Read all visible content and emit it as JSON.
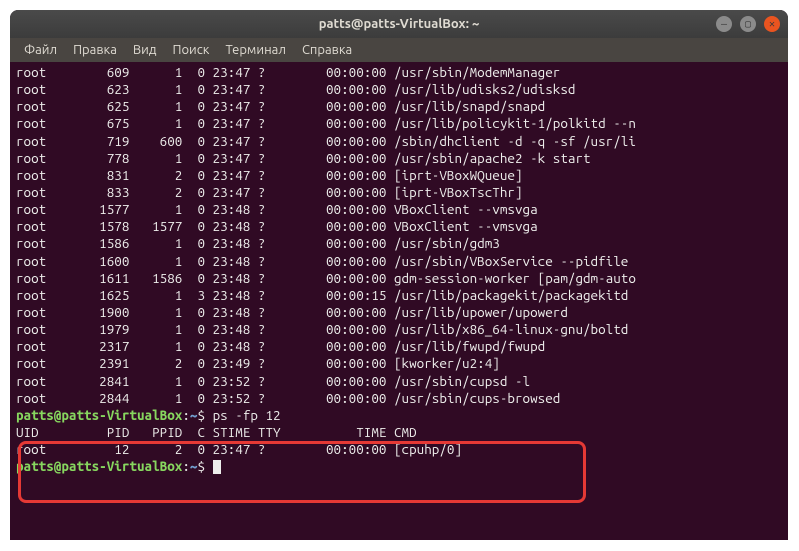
{
  "window": {
    "title": "patts@patts-VirtualBox: ~"
  },
  "menu": {
    "file": "Файл",
    "edit": "Правка",
    "view": "Вид",
    "search": "Поиск",
    "terminal": "Терминал",
    "help": "Справка"
  },
  "ps_rows": [
    {
      "uid": "root",
      "pid": "609",
      "ppid": "1",
      "c": "0",
      "stime": "23:47",
      "tty": "?",
      "time": "00:00:00",
      "cmd": "/usr/sbin/ModemManager"
    },
    {
      "uid": "root",
      "pid": "623",
      "ppid": "1",
      "c": "0",
      "stime": "23:47",
      "tty": "?",
      "time": "00:00:00",
      "cmd": "/usr/lib/udisks2/udisksd"
    },
    {
      "uid": "root",
      "pid": "625",
      "ppid": "1",
      "c": "0",
      "stime": "23:47",
      "tty": "?",
      "time": "00:00:00",
      "cmd": "/usr/lib/snapd/snapd"
    },
    {
      "uid": "root",
      "pid": "675",
      "ppid": "1",
      "c": "0",
      "stime": "23:47",
      "tty": "?",
      "time": "00:00:00",
      "cmd": "/usr/lib/policykit-1/polkitd --n"
    },
    {
      "uid": "root",
      "pid": "719",
      "ppid": "600",
      "c": "0",
      "stime": "23:47",
      "tty": "?",
      "time": "00:00:00",
      "cmd": "/sbin/dhclient -d -q -sf /usr/li"
    },
    {
      "uid": "root",
      "pid": "778",
      "ppid": "1",
      "c": "0",
      "stime": "23:47",
      "tty": "?",
      "time": "00:00:00",
      "cmd": "/usr/sbin/apache2 -k start"
    },
    {
      "uid": "root",
      "pid": "831",
      "ppid": "2",
      "c": "0",
      "stime": "23:47",
      "tty": "?",
      "time": "00:00:00",
      "cmd": "[iprt-VBoxWQueue]"
    },
    {
      "uid": "root",
      "pid": "833",
      "ppid": "2",
      "c": "0",
      "stime": "23:47",
      "tty": "?",
      "time": "00:00:00",
      "cmd": "[iprt-VBoxTscThr]"
    },
    {
      "uid": "root",
      "pid": "1577",
      "ppid": "1",
      "c": "0",
      "stime": "23:48",
      "tty": "?",
      "time": "00:00:00",
      "cmd": "VBoxClient --vmsvga"
    },
    {
      "uid": "root",
      "pid": "1578",
      "ppid": "1577",
      "c": "0",
      "stime": "23:48",
      "tty": "?",
      "time": "00:00:00",
      "cmd": "VBoxClient --vmsvga"
    },
    {
      "uid": "root",
      "pid": "1586",
      "ppid": "1",
      "c": "0",
      "stime": "23:48",
      "tty": "?",
      "time": "00:00:00",
      "cmd": "/usr/sbin/gdm3"
    },
    {
      "uid": "root",
      "pid": "1600",
      "ppid": "1",
      "c": "0",
      "stime": "23:48",
      "tty": "?",
      "time": "00:00:00",
      "cmd": "/usr/sbin/VBoxService --pidfile"
    },
    {
      "uid": "root",
      "pid": "1611",
      "ppid": "1586",
      "c": "0",
      "stime": "23:48",
      "tty": "?",
      "time": "00:00:00",
      "cmd": "gdm-session-worker [pam/gdm-auto"
    },
    {
      "uid": "root",
      "pid": "1625",
      "ppid": "1",
      "c": "3",
      "stime": "23:48",
      "tty": "?",
      "time": "00:00:15",
      "cmd": "/usr/lib/packagekit/packagekitd"
    },
    {
      "uid": "root",
      "pid": "1900",
      "ppid": "1",
      "c": "0",
      "stime": "23:48",
      "tty": "?",
      "time": "00:00:00",
      "cmd": "/usr/lib/upower/upowerd"
    },
    {
      "uid": "root",
      "pid": "1979",
      "ppid": "1",
      "c": "0",
      "stime": "23:48",
      "tty": "?",
      "time": "00:00:00",
      "cmd": "/usr/lib/x86_64-linux-gnu/boltd"
    },
    {
      "uid": "root",
      "pid": "2317",
      "ppid": "1",
      "c": "0",
      "stime": "23:48",
      "tty": "?",
      "time": "00:00:00",
      "cmd": "/usr/lib/fwupd/fwupd"
    },
    {
      "uid": "root",
      "pid": "2391",
      "ppid": "2",
      "c": "0",
      "stime": "23:49",
      "tty": "?",
      "time": "00:00:00",
      "cmd": "[kworker/u2:4]"
    },
    {
      "uid": "root",
      "pid": "2841",
      "ppid": "1",
      "c": "0",
      "stime": "23:52",
      "tty": "?",
      "time": "00:00:00",
      "cmd": "/usr/sbin/cupsd -l"
    },
    {
      "uid": "root",
      "pid": "2844",
      "ppid": "1",
      "c": "0",
      "stime": "23:52",
      "tty": "?",
      "time": "00:00:00",
      "cmd": "/usr/sbin/cups-browsed"
    }
  ],
  "prompt": {
    "user_host": "patts@patts-VirtualBox",
    "sep": ":",
    "path": "~",
    "sym": "$",
    "cmd1": "ps -fp 12"
  },
  "header": {
    "line": "UID         PID   PPID  C STIME TTY          TIME CMD"
  },
  "result_row": {
    "uid": "root",
    "pid": "12",
    "ppid": "2",
    "c": "0",
    "stime": "23:47",
    "tty": "?",
    "time": "00:00:00",
    "cmd": "[cpuhp/0]"
  }
}
